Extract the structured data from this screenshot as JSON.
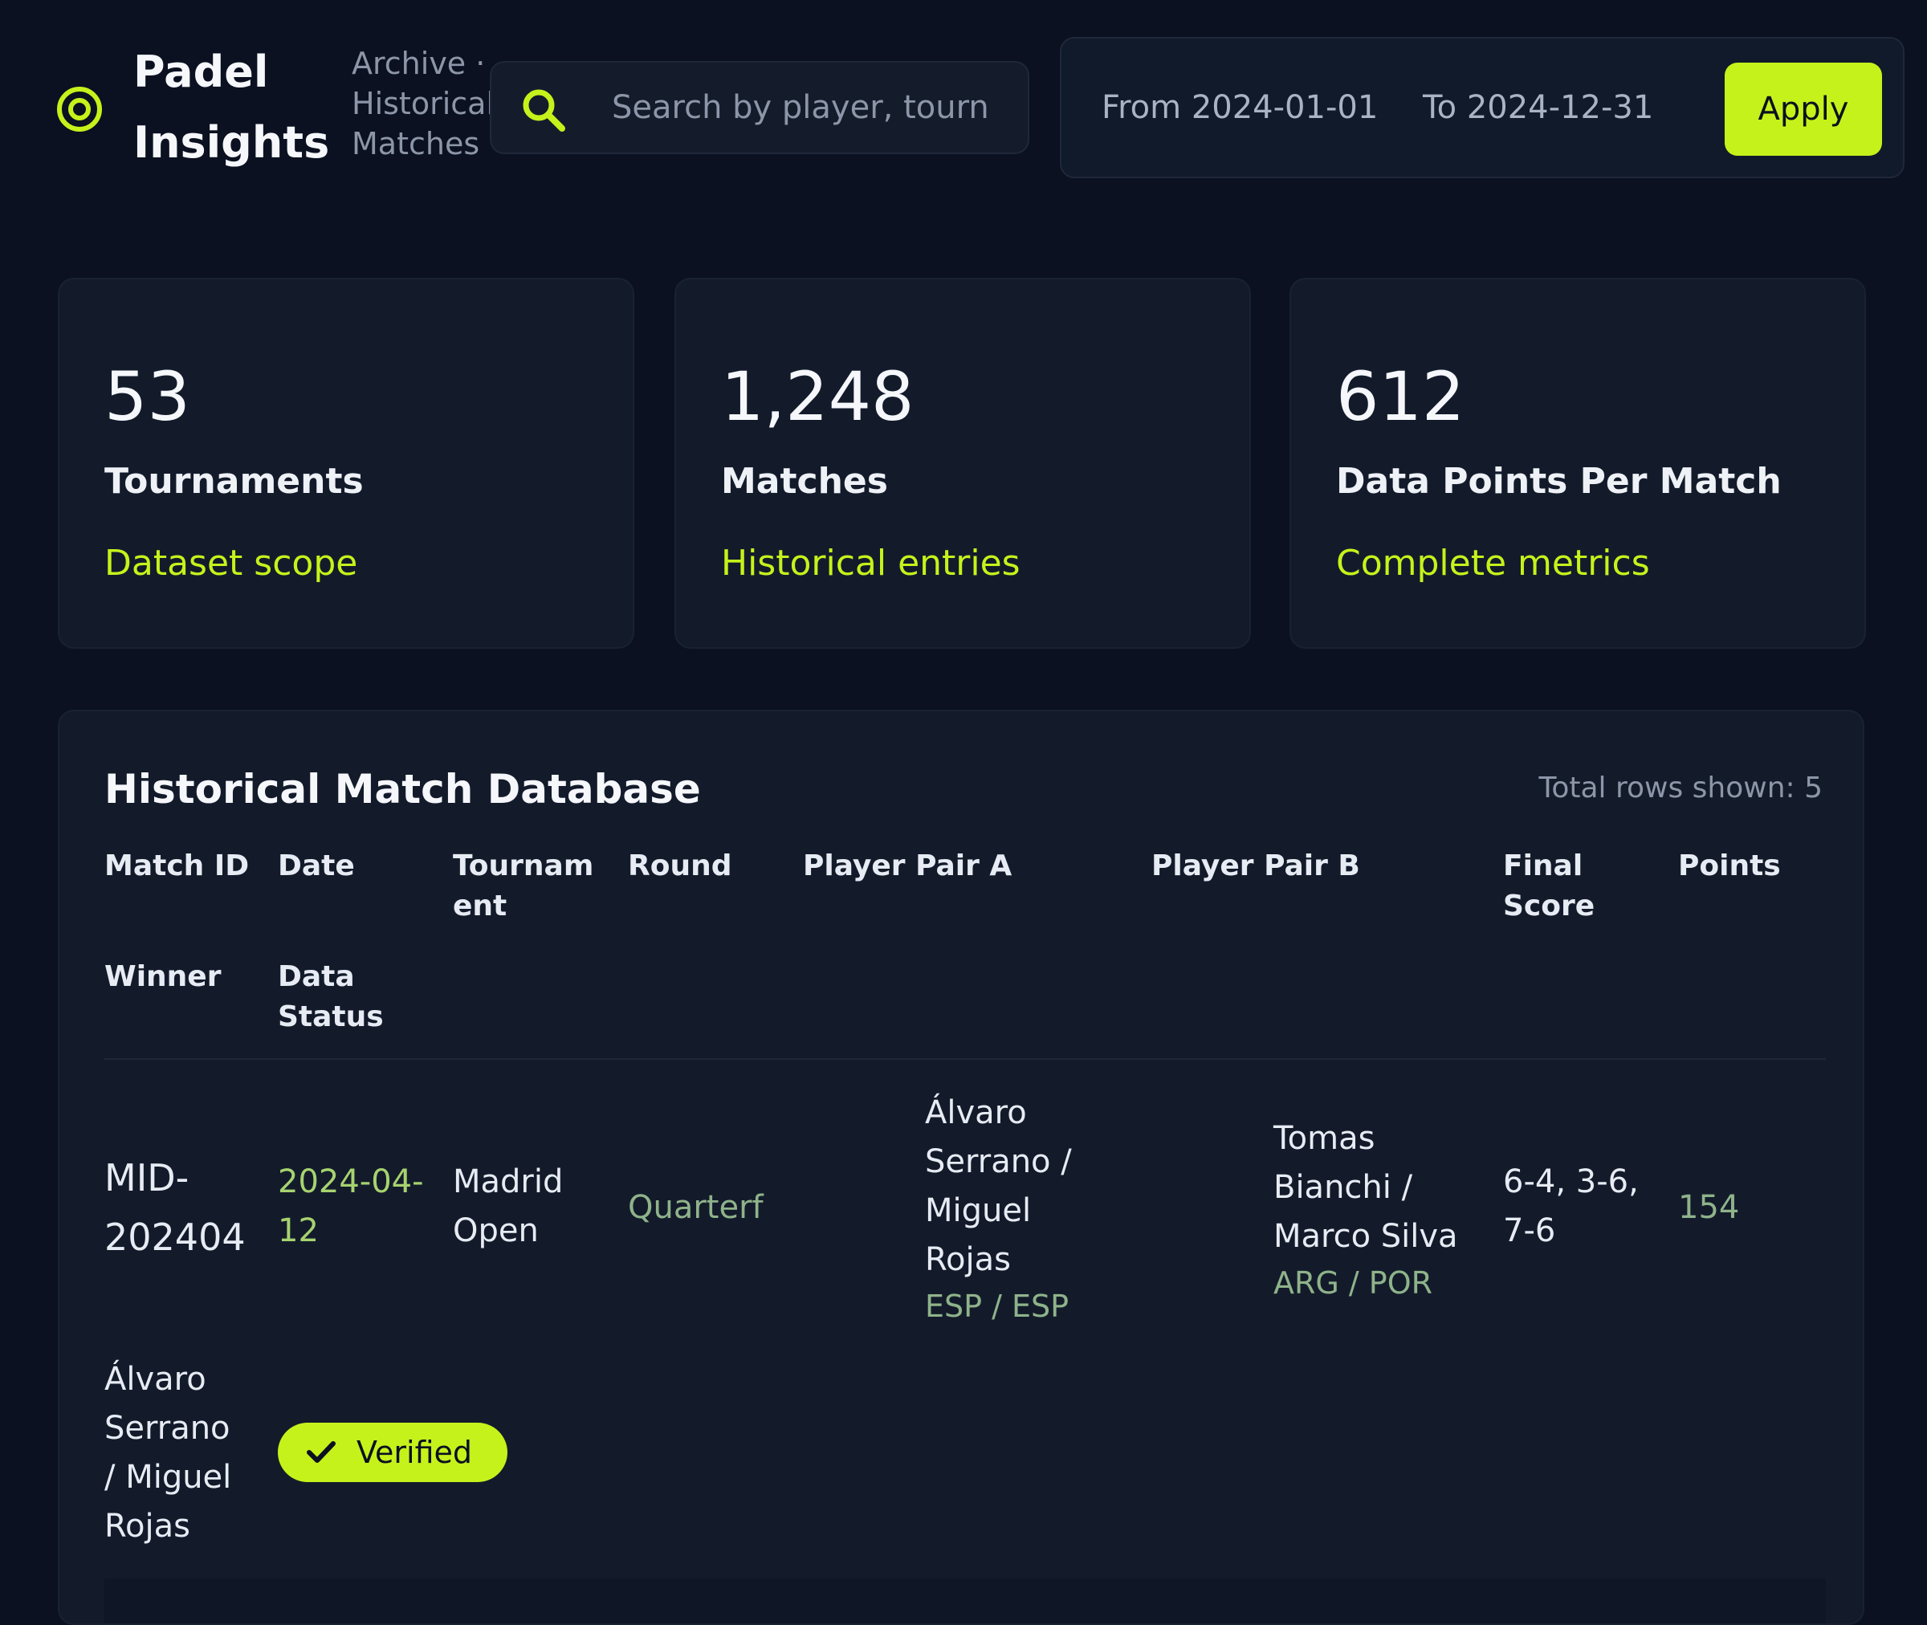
{
  "header": {
    "brand_line1": "Padel",
    "brand_line2": "Insights",
    "breadcrumb": [
      "Archive ·",
      "Historical",
      "Matches"
    ],
    "search_placeholder": "Search by player, tourn",
    "date_from": "From 2024-01-01",
    "date_to": "To 2024-12-31",
    "apply_label": "Apply"
  },
  "stats": [
    {
      "value": "53",
      "label": "Tournaments",
      "sub": "Dataset scope"
    },
    {
      "value": "1,248",
      "label": "Matches",
      "sub": "Historical entries"
    },
    {
      "value": "612",
      "label": "Data Points Per Match",
      "sub": "Complete metrics"
    }
  ],
  "table": {
    "title": "Historical Match Database",
    "count": "Total rows shown: 5",
    "headers": {
      "match_id": "Match ID",
      "date": "Date",
      "tournament": [
        "Tournam",
        "ent"
      ],
      "round": "Round",
      "pair_a": "Player Pair A",
      "pair_b": "Player Pair B",
      "final_score": [
        "Final",
        "Score"
      ],
      "points": "Points",
      "winner": "Winner",
      "data_status": [
        "Data",
        "Status"
      ]
    },
    "rows": [
      {
        "match_id": [
          "MID-",
          "202404"
        ],
        "date": [
          "2024-04-",
          "12"
        ],
        "tournament": [
          "Madrid",
          "Open"
        ],
        "round": "Quarterf",
        "pair_a": [
          "Álvaro",
          "Serrano /",
          "Miguel",
          "Rojas"
        ],
        "pair_a_countries": "ESP / ESP",
        "pair_b": [
          "Tomas",
          "Bianchi /",
          "Marco Silva"
        ],
        "pair_b_countries": "ARG / POR",
        "final_score": [
          "6-4, 3-6,",
          "7-6"
        ],
        "points": "154",
        "winner": [
          "Álvaro",
          "Serrano",
          "/ Miguel",
          "Rojas"
        ],
        "status": "Verified"
      }
    ]
  },
  "colors": {
    "accent": "#c6f21b",
    "background": "#0b1120",
    "card": "#131b2b",
    "muted_green": "#8fb38a"
  }
}
